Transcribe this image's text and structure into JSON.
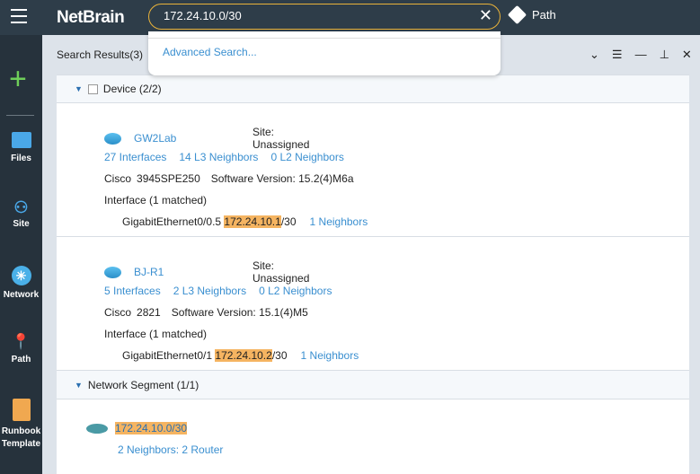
{
  "header": {
    "logo": "NetBrain",
    "search_value": "172.24.10.0/30",
    "path_label": "Path"
  },
  "dropdown": {
    "advanced": "Advanced Search..."
  },
  "sidebar": {
    "items": [
      {
        "label": "Files"
      },
      {
        "label": "Site"
      },
      {
        "label": "Network"
      },
      {
        "label": "Path"
      },
      {
        "label": "Runbook Template"
      }
    ]
  },
  "results": {
    "title": "Search Results(3)",
    "device_section": "Device (2/2)",
    "devices": [
      {
        "name": "GW2Lab",
        "site": "Site: Unassigned",
        "interfaces": "27 Interfaces",
        "l3": "14 L3 Neighbors",
        "l2": "0 L2 Neighbors",
        "vendor": "Cisco",
        "model": "3945SPE250",
        "software": "Software Version: 15.2(4)M6a",
        "matched": "Interface (1 matched)",
        "iface": "GigabitEthernet0/0.5",
        "ip": "172.24.10.1",
        "mask": "/30",
        "neighbors": "1 Neighbors"
      },
      {
        "name": "BJ-R1",
        "site": "Site: Unassigned",
        "interfaces": "5 Interfaces",
        "l3": "2 L3 Neighbors",
        "l2": "0 L2 Neighbors",
        "vendor": "Cisco",
        "model": "2821",
        "software": "Software Version: 15.1(4)M5",
        "matched": "Interface (1 matched)",
        "iface": "GigabitEthernet0/1",
        "ip": "172.24.10.2",
        "mask": "/30",
        "neighbors": "1 Neighbors"
      }
    ],
    "segment_section": "Network Segment (1/1)",
    "segment": {
      "name": "172.24.10.0/30",
      "neighbors": "2 Neighbors: 2 Router"
    }
  }
}
